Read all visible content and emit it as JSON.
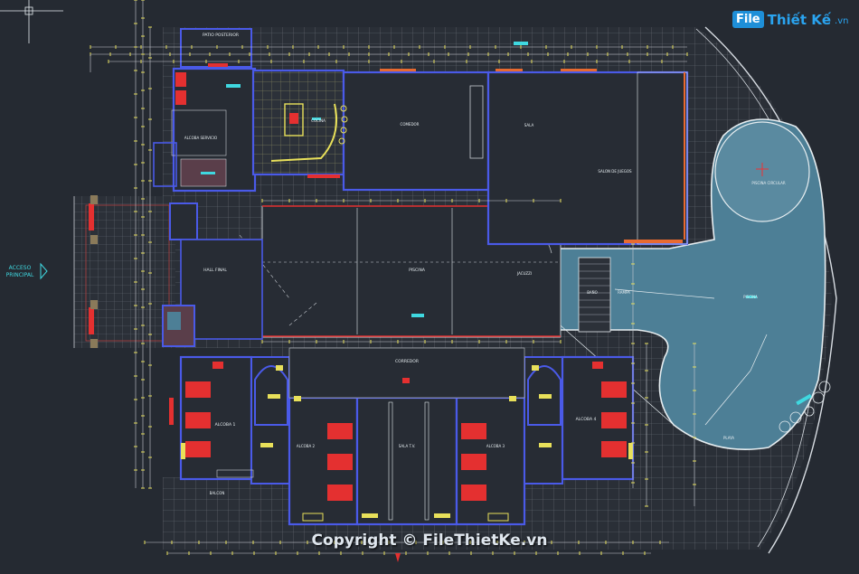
{
  "brand": {
    "mark": "File",
    "name": "Thiết Kế",
    "tld": ".vn"
  },
  "labels": {
    "patio_top": "PATIO POSTERIOR",
    "cocina_serv": "ALCOBA SERVICIO",
    "cocina": "COCINA",
    "comedor": "COMEDOR",
    "sala": "SALA",
    "salon_juegos": "SALON DE JUEGOS",
    "piscina_circ": "PISCINA CIRCULAR",
    "acceso": "ACCESO",
    "principal": "PRINCIPAL",
    "hall": "HALL FINAL",
    "piscina": "PISCINA",
    "jacuzzi": "JACUZZI",
    "banos": "BAÑO",
    "rampa": "RAMPA",
    "corredor": "CORREDOR",
    "alcoba1": "ALCOBA 1",
    "alcoba2": "ALCOBA 2",
    "alcoba3": "ALCOBA 3",
    "alcoba4": "ALCOBA 4",
    "sala_tv": "SALA T.V.",
    "balcon": "BALCON",
    "playa": "PLAYA"
  },
  "watermark": {
    "text": "Copyright © FileThietKe.vn"
  },
  "colors": {
    "background": "#252a32",
    "wall": "#4a5ae8",
    "dim": "#e8e05a",
    "furniture": "#e43030",
    "pool": "#4d7f96",
    "grid": "#5a6068",
    "label": "#3fd8e0"
  }
}
